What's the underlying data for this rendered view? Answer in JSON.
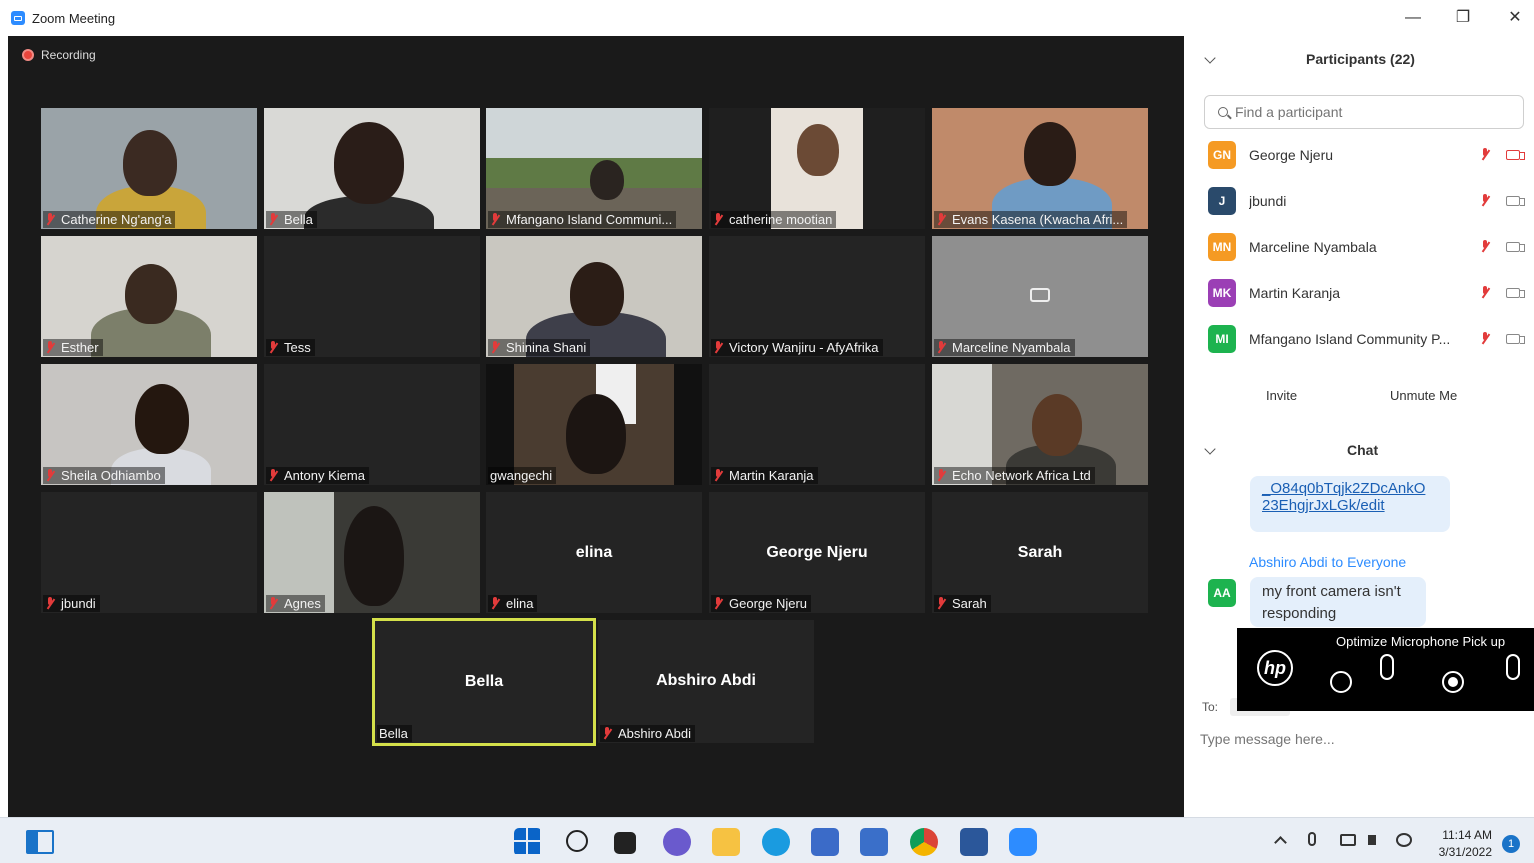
{
  "window": {
    "title": "Zoom Meeting",
    "minimize": "—",
    "restore": "❐",
    "close": "✕"
  },
  "meeting": {
    "recording_label": "Recording",
    "tiles": [
      {
        "name": "Catherine Ng'ang'a"
      },
      {
        "name": "Bella"
      },
      {
        "name": "Mfangano Island Communi..."
      },
      {
        "name": "catherine mootian"
      },
      {
        "name": "Evans Kasena (Kwacha Afri..."
      },
      {
        "name": "Esther"
      },
      {
        "name": "Tess"
      },
      {
        "name": "Shinina Shani"
      },
      {
        "name": "Victory Wanjiru - AfyAfrika"
      },
      {
        "name": "Marceline Nyambala"
      },
      {
        "name": "Sheila Odhiambo"
      },
      {
        "name": "Antony Kiema"
      },
      {
        "name": "gwangechi"
      },
      {
        "name": "Martin Karanja"
      },
      {
        "name": "Echo Network Africa Ltd"
      },
      {
        "name": "jbundi"
      },
      {
        "name": "Agnes"
      },
      {
        "name": "elina",
        "big": "elina"
      },
      {
        "name": "George Njeru",
        "big": "George Njeru"
      },
      {
        "name": "Sarah",
        "big": "Sarah"
      },
      {
        "name": "Bella",
        "big": "Bella"
      },
      {
        "name": "Abshiro Abdi",
        "big": "Abshiro Abdi"
      }
    ]
  },
  "participants": {
    "header": "Participants (22)",
    "search_placeholder": "Find a participant",
    "list": [
      {
        "initials": "GN",
        "name": "George Njeru",
        "color": "#f59a23"
      },
      {
        "initials": "J",
        "name": "jbundi",
        "color": "#2a4a6b"
      },
      {
        "initials": "MN",
        "name": "Marceline Nyambala",
        "color": "#f59a23"
      },
      {
        "initials": "MK",
        "name": "Martin Karanja",
        "color": "#9b3fb5"
      },
      {
        "initials": "MI",
        "name": "Mfangano Island Community P...",
        "color": "#1db34f"
      }
    ],
    "invite_label": "Invite",
    "unmute_label": "Unmute Me"
  },
  "chat": {
    "header": "Chat",
    "link_line1": "_O84q0bTqjk2ZDcAnkO",
    "link_line2": "23EhgjrJxLGk/edit",
    "sender": "Abshiro Abdi",
    "to_word": "to",
    "recipient": "Everyone",
    "sender_initials": "AA",
    "message": "my front camera isn't responding",
    "to_label": "To:",
    "input_placeholder": "Type message here..."
  },
  "hp_overlay": {
    "title": "Optimize Microphone Pick up"
  },
  "taskbar": {
    "time": "11:14 AM",
    "date": "3/31/2022",
    "notification_count": "1"
  }
}
